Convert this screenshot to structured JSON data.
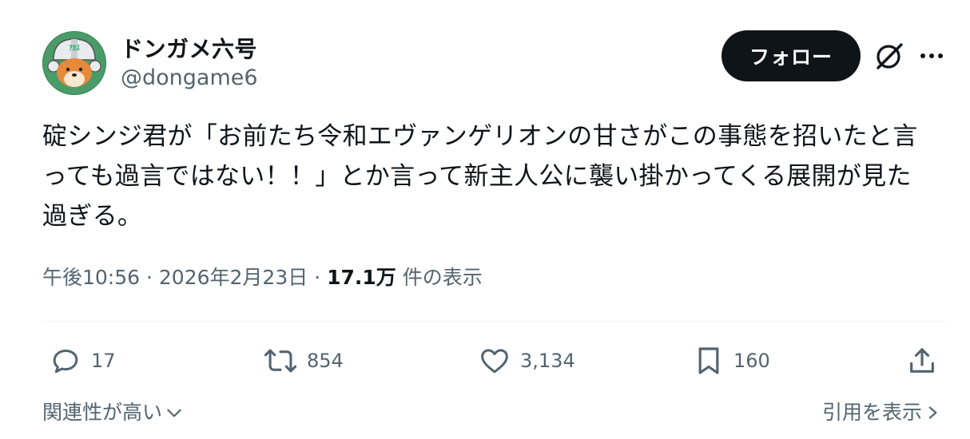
{
  "author": {
    "name": "ドンガメ六号",
    "handle": "@dongame6",
    "avatar_text": "ｱｶｽ"
  },
  "header": {
    "follow_label": "フォロー",
    "grok_icon": "grok-icon",
    "more_icon": "more-icon"
  },
  "tweet": {
    "lines": [
      "碇シンジ君が「お前たち令和エヴァンゲリオンの甘さがこの事態を招いたと言",
      "っても過言ではない！！」とか言って新主人公に襲い掛かってくる展開が見た",
      "過ぎる。"
    ]
  },
  "meta": {
    "time": "午後10:56",
    "sep1": " · ",
    "date": "2026年2月23日",
    "sep2": " · ",
    "views": "17.1万",
    "views_suffix": " 件の表示"
  },
  "actions": {
    "replies": "17",
    "retweets": "854",
    "likes": "3,134",
    "bookmarks": "160"
  },
  "footer": {
    "sort_label": "関連性が高い",
    "quotes_label": "引用を表示"
  },
  "colors": {
    "text_primary": "#0f1419",
    "text_secondary": "#536471",
    "follow_bg": "#0f1419",
    "divider": "#eff3f4",
    "avatar_bg": "#2e7d4f"
  }
}
